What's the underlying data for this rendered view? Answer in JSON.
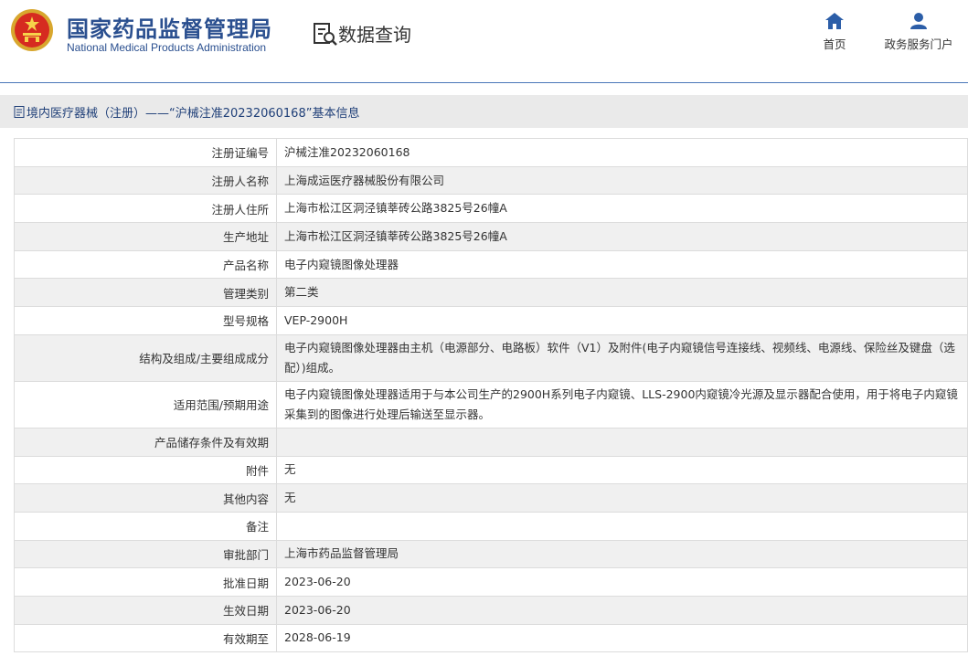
{
  "header": {
    "brand_cn": "国家药品监督管理局",
    "brand_en": "National Medical Products Administration",
    "section_title": "数据查询",
    "nav": [
      {
        "label": "首页",
        "icon": "home-icon"
      },
      {
        "label": "政务服务门户",
        "icon": "user-icon"
      }
    ]
  },
  "breadcrumb": {
    "icon": "document-icon",
    "text": "境内医疗器械（注册）——“沪械注准20232060168”基本信息"
  },
  "rows": [
    {
      "label": "注册证编号",
      "value": "沪械注准20232060168"
    },
    {
      "label": "注册人名称",
      "value": "上海成运医疗器械股份有限公司"
    },
    {
      "label": "注册人住所",
      "value": "上海市松江区洞泾镇莘砖公路3825号26幢A"
    },
    {
      "label": "生产地址",
      "value": "上海市松江区洞泾镇莘砖公路3825号26幢A"
    },
    {
      "label": "产品名称",
      "value": "电子内窥镜图像处理器"
    },
    {
      "label": "管理类别",
      "value": "第二类"
    },
    {
      "label": "型号规格",
      "value": "VEP-2900H"
    },
    {
      "label": "结构及组成/主要组成成分",
      "value": "电子内窥镜图像处理器由主机（电源部分、电路板）软件（V1）及附件(电子内窥镜信号连接线、视频线、电源线、保险丝及键盘（选配）)组成。"
    },
    {
      "label": "适用范围/预期用途",
      "value": "电子内窥镜图像处理器适用于与本公司生产的2900H系列电子内窥镜、LLS-2900内窥镜冷光源及显示器配合使用，用于将电子内窥镜采集到的图像进行处理后输送至显示器。"
    },
    {
      "label": "产品储存条件及有效期",
      "value": ""
    },
    {
      "label": "附件",
      "value": "无"
    },
    {
      "label": "其他内容",
      "value": "无"
    },
    {
      "label": "备注",
      "value": ""
    },
    {
      "label": "审批部门",
      "value": "上海市药品监督管理局"
    },
    {
      "label": "批准日期",
      "value": "2023-06-20"
    },
    {
      "label": "生效日期",
      "value": "2023-06-20"
    },
    {
      "label": "有效期至",
      "value": "2028-06-19"
    }
  ],
  "colors": {
    "brand_blue": "#2a4f8f",
    "nav_icon_blue": "#2c5ea8",
    "breadcrumb_bg": "#eaeaea",
    "row_alt_bg": "#f0f0f0"
  }
}
